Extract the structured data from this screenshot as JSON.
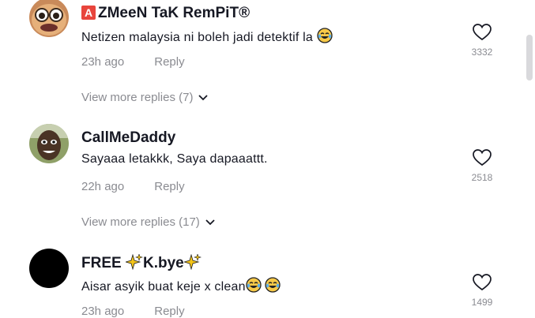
{
  "comments": [
    {
      "badge": "A",
      "username": "ZMeeN TaK RemPiT®",
      "text": "Netizen malaysia ni boleh jadi detektif la",
      "time": "23h ago",
      "reply_label": "Reply",
      "likes": "3332",
      "view_more": "View more replies (7)",
      "avatar_icon": "cartoon-face-avatar"
    },
    {
      "username": "CallMeDaddy",
      "text": "Sayaaa letakkk, Saya dapaaattt.",
      "time": "22h ago",
      "reply_label": "Reply",
      "likes": "2518",
      "view_more": "View more replies (17)",
      "avatar_icon": "photo-face-avatar"
    },
    {
      "username_start": "FREE",
      "username_end": "K.bye",
      "text": "Aisar asyik buat keje x clean",
      "time": "23h ago",
      "reply_label": "Reply",
      "likes": "1499",
      "avatar_icon": "black-circle-avatar"
    }
  ],
  "colors": {
    "primary_text": "#161823",
    "secondary_text": "#8a8b91",
    "badge_red": "#e8453c"
  }
}
